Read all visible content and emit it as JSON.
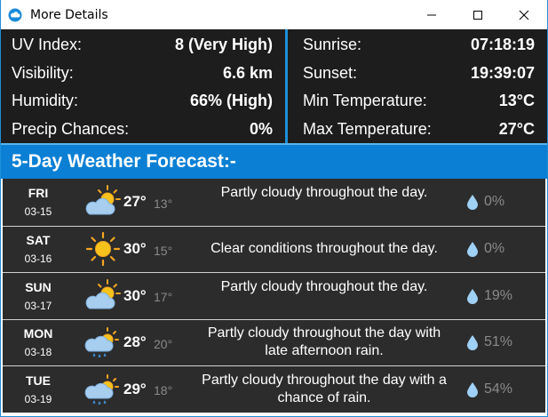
{
  "window": {
    "title": "More Details",
    "app_icon": "cloud-icon"
  },
  "details": {
    "left": [
      {
        "label": "UV Index:",
        "value": "8 (Very High)"
      },
      {
        "label": "Visibility:",
        "value": "6.6 km"
      },
      {
        "label": "Humidity:",
        "value": "66% (High)"
      },
      {
        "label": "Precip Chances:",
        "value": "0%"
      }
    ],
    "right": [
      {
        "label": "Sunrise:",
        "value": "07:18:19"
      },
      {
        "label": "Sunset:",
        "value": "19:39:07"
      },
      {
        "label": "Min Temperature:",
        "value": "13°C"
      },
      {
        "label": "Max Temperature:",
        "value": "27°C"
      }
    ]
  },
  "forecast": {
    "title": "5-Day Weather Forecast:-",
    "days": [
      {
        "day": "FRI",
        "date": "03-15",
        "icon": "partly-cloudy-icon",
        "high": "27°",
        "low": "13°",
        "desc": "Partly cloudy throughout the day.",
        "precip": "0%"
      },
      {
        "day": "SAT",
        "date": "03-16",
        "icon": "sun-icon",
        "high": "30°",
        "low": "15°",
        "desc": "Clear conditions throughout the day.",
        "precip": "0%"
      },
      {
        "day": "SUN",
        "date": "03-17",
        "icon": "partly-cloudy-icon",
        "high": "30°",
        "low": "17°",
        "desc": "Partly cloudy throughout the day.",
        "precip": "19%"
      },
      {
        "day": "MON",
        "date": "03-18",
        "icon": "rain-sun-icon",
        "high": "28°",
        "low": "20°",
        "desc": "Partly cloudy throughout the day with late afternoon rain.",
        "precip": "51%"
      },
      {
        "day": "TUE",
        "date": "03-19",
        "icon": "rain-sun-icon",
        "high": "29°",
        "low": "18°",
        "desc": "Partly cloudy throughout the day with a chance of rain.",
        "precip": "54%"
      }
    ]
  },
  "colors": {
    "accent": "#0a7fd4",
    "panel_bg": "#1d1d1d",
    "row_bg": "#2c2c2c",
    "muted": "#8a8a8a"
  }
}
